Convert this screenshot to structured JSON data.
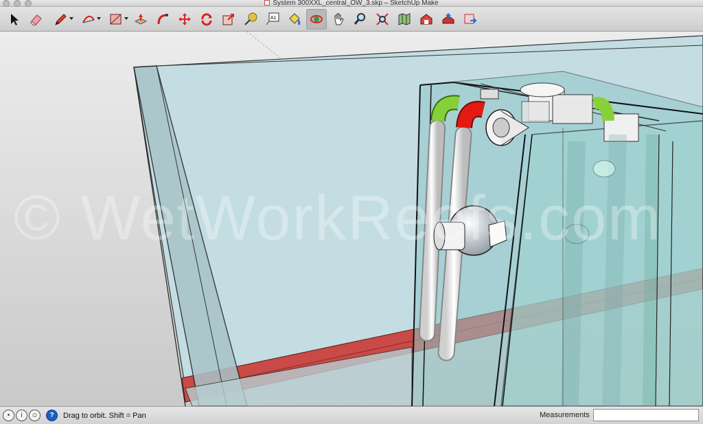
{
  "window": {
    "title": "System 300XXL_central_OW_3.skp – SketchUp Make"
  },
  "toolbar": {
    "tools": [
      {
        "name": "select-tool",
        "icon": "arrow-cursor-icon"
      },
      {
        "name": "eraser-tool",
        "icon": "eraser-icon"
      },
      {
        "name": "pencil-tool",
        "icon": "pencil-icon"
      },
      {
        "name": "arc-tool",
        "icon": "arc-icon"
      },
      {
        "name": "rectangle-tool",
        "icon": "rectangle-icon"
      },
      {
        "name": "push-pull-tool",
        "icon": "push-pull-icon"
      },
      {
        "name": "follow-me-tool",
        "icon": "follow-me-icon"
      },
      {
        "name": "move-tool",
        "icon": "move-icon"
      },
      {
        "name": "rotate-tool",
        "icon": "rotate-icon"
      },
      {
        "name": "scale-tool",
        "icon": "scale-icon"
      },
      {
        "name": "tape-measure-tool",
        "icon": "tape-measure-icon"
      },
      {
        "name": "text-tool",
        "icon": "text-icon"
      },
      {
        "name": "paint-bucket-tool",
        "icon": "paint-bucket-icon"
      },
      {
        "name": "orbit-tool",
        "icon": "orbit-icon"
      },
      {
        "name": "pan-tool",
        "icon": "hand-icon"
      },
      {
        "name": "zoom-tool",
        "icon": "magnifier-icon"
      },
      {
        "name": "zoom-extents-tool",
        "icon": "zoom-extents-icon"
      },
      {
        "name": "add-location-tool",
        "icon": "map-icon"
      },
      {
        "name": "get-models-tool",
        "icon": "warehouse-icon"
      },
      {
        "name": "share-model-tool",
        "icon": "share-icon"
      },
      {
        "name": "extension-warehouse-tool",
        "icon": "extension-icon"
      }
    ],
    "text_tool_glyph": "A1"
  },
  "viewport": {
    "watermark": "© WetWorkReefs.com"
  },
  "status": {
    "message": "Drag to orbit.  Shift = Pan",
    "measurements_label": "Measurements",
    "measurements_value": ""
  },
  "colors": {
    "glass": "#c5dfe4",
    "glass_dark": "#6fa9ae",
    "red_trim": "#c94a46",
    "pipe_green": "#86d13a",
    "pipe_red": "#e21a12"
  }
}
